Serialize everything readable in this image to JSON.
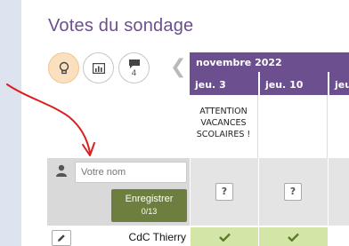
{
  "page": {
    "title": "Votes du sondage"
  },
  "toolbar": {
    "buttons": [
      {
        "name": "lightbulb-icon",
        "active": true
      },
      {
        "name": "bar-chart-icon",
        "active": false
      },
      {
        "name": "comment-icon",
        "active": false,
        "count": "4"
      }
    ]
  },
  "poll": {
    "month": "novembre 2022",
    "days": [
      "jeu. 3",
      "jeu. 10",
      "jeu"
    ],
    "comments": [
      "ATTENTION\nVACANCES\nSCOLAIRES !",
      "",
      ""
    ]
  },
  "new_vote": {
    "name_placeholder": "Votre nom",
    "save_label": "Enregistrer",
    "save_count": "0/13",
    "cell_value": "?"
  },
  "votes": [
    {
      "name": "CdC Thierry",
      "answers": [
        "yes",
        "yes",
        ""
      ]
    }
  ],
  "colors": {
    "accent": "#6b4f8e",
    "save_button": "#6d7f3f",
    "yes_cell": "#d4e5a8",
    "annotation_arrow": "#d9201e"
  }
}
